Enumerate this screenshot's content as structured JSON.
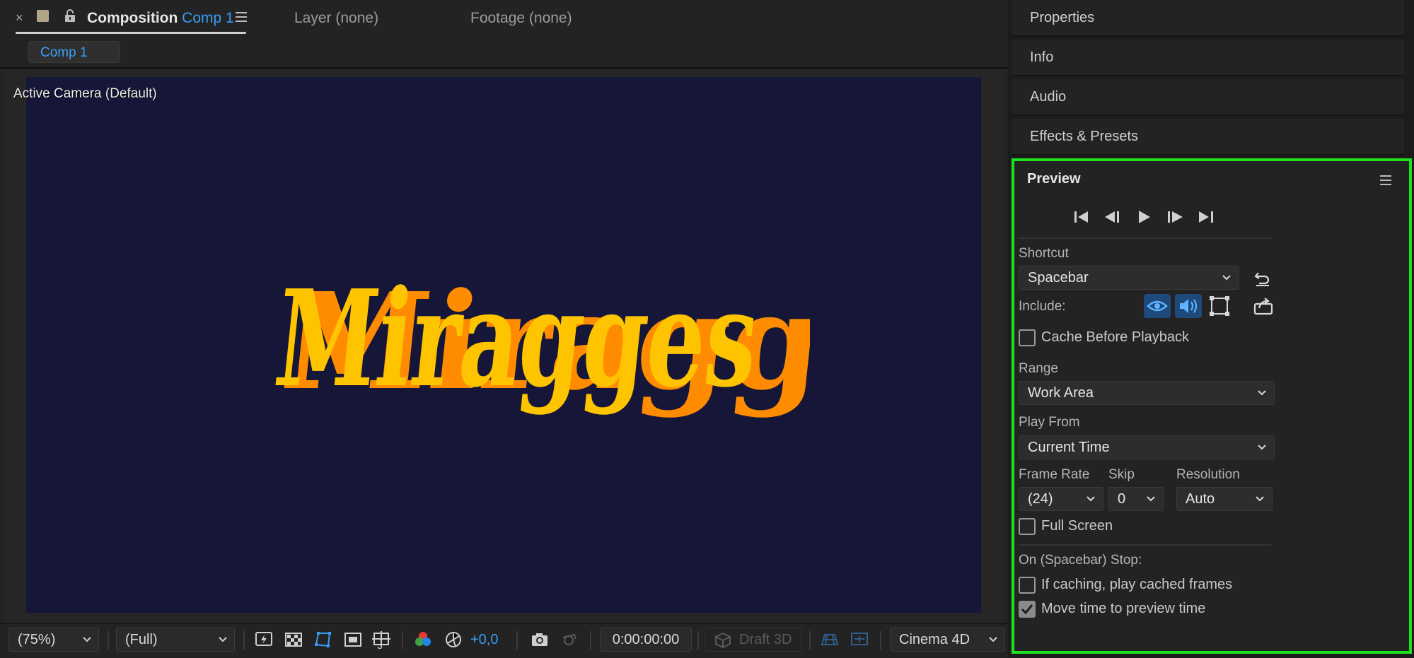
{
  "composition_panel": {
    "tab_title": "Composition",
    "comp_name": "Comp 1",
    "other_tabs": [
      "Layer (none)",
      "Footage (none)"
    ],
    "active_comp_chip": "Comp 1",
    "camera_label": "Active Camera (Default)",
    "canvas_text": "Miragges",
    "colors": {
      "canvas_bg": "#161738",
      "text_face": "#ffc400",
      "text_side": "#ff8c00",
      "accent": "#3b9cf5"
    }
  },
  "bottom_toolbar": {
    "zoom": "(75%)",
    "resolution": "(Full)",
    "exposure": "+0,0",
    "timecode": "0:00:00:00",
    "draft3d": "Draft 3D",
    "renderer": "Cinema 4D",
    "icons": [
      "fast-previews-icon",
      "transparency-grid-icon",
      "mask-path-icon",
      "region-of-interest-icon",
      "guides-icon",
      "channel-icon",
      "exposure-reset-icon",
      "snapshot-icon",
      "show-snapshot-icon",
      "3d-view-icon",
      "3d-ground-icon"
    ]
  },
  "right_panels": {
    "properties": "Properties",
    "info": "Info",
    "audio": "Audio",
    "effects": "Effects & Presets"
  },
  "preview": {
    "title": "Preview",
    "transport": [
      "first-frame-icon",
      "previous-frame-icon",
      "play-icon",
      "next-frame-icon",
      "last-frame-icon"
    ],
    "shortcut_label": "Shortcut",
    "shortcut_value": "Spacebar",
    "include_label": "Include:",
    "cache_before_playback": {
      "label": "Cache Before Playback",
      "checked": false
    },
    "range_label": "Range",
    "range_value": "Work Area",
    "play_from_label": "Play From",
    "play_from_value": "Current Time",
    "frame_rate_label": "Frame Rate",
    "frame_rate_value": "(24)",
    "skip_label": "Skip",
    "skip_value": "0",
    "resolution_label": "Resolution",
    "resolution_value": "Auto",
    "full_screen": {
      "label": "Full Screen",
      "checked": false
    },
    "on_stop_label": "On (Spacebar) Stop:",
    "if_caching": {
      "label": "If caching, play cached frames",
      "checked": false
    },
    "move_time": {
      "label": "Move time to preview time",
      "checked": true
    },
    "highlight_color": "#1ee21e"
  }
}
